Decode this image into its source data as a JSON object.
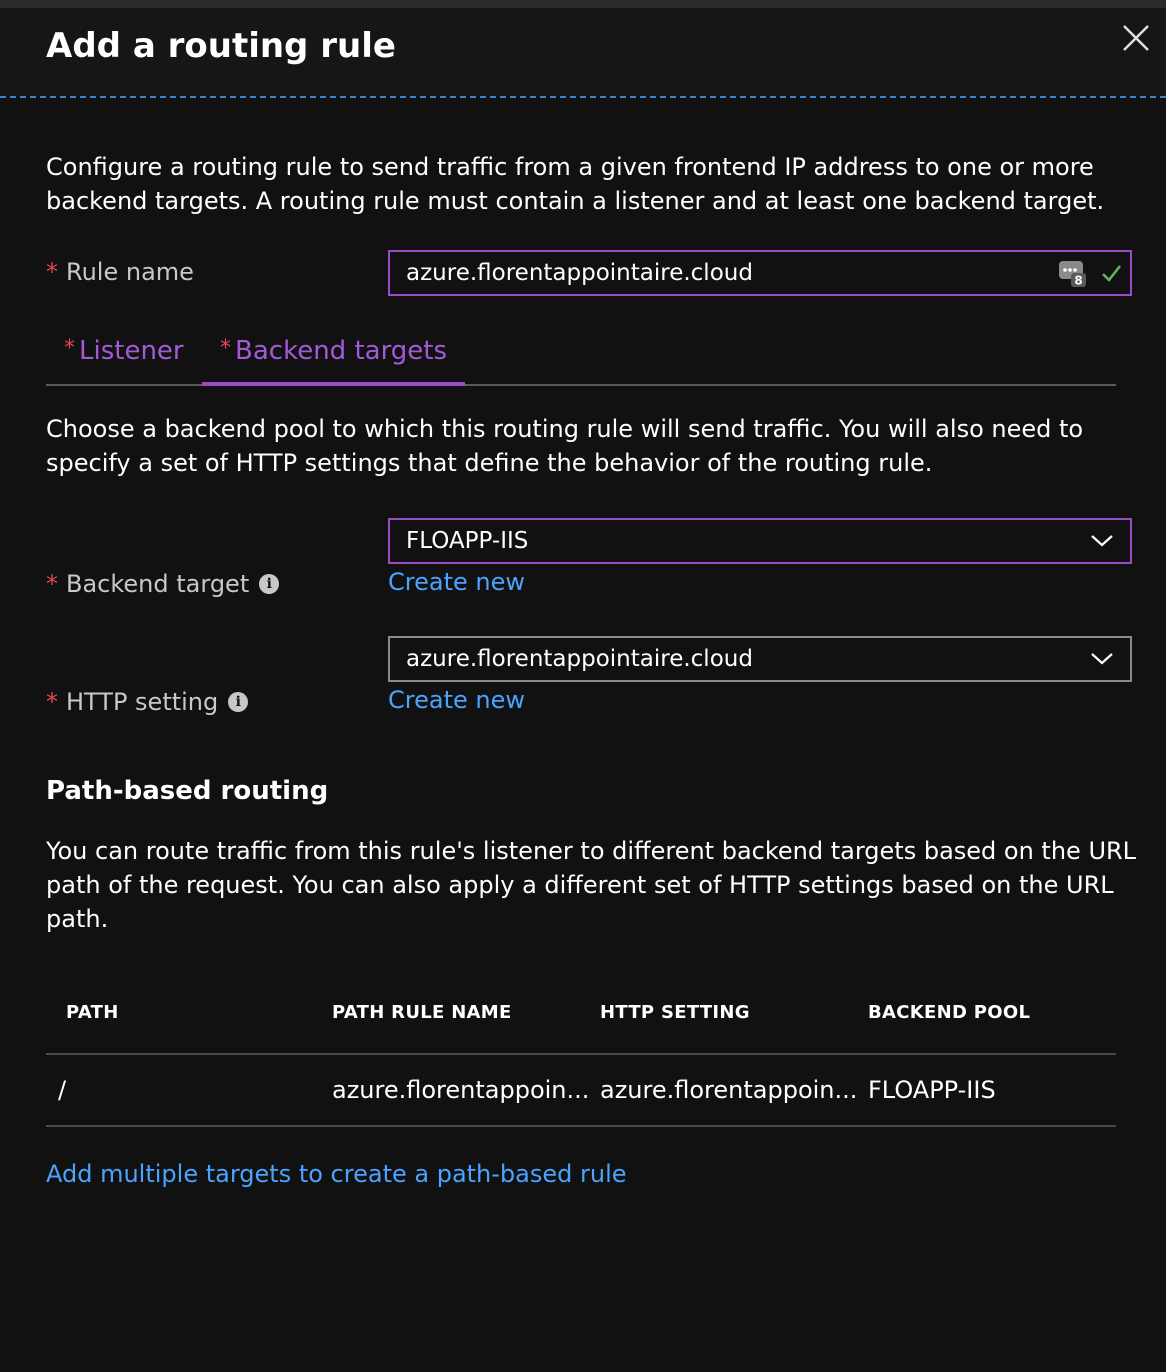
{
  "header": {
    "title": "Add a routing rule"
  },
  "intro": {
    "line1": "Configure a routing rule to send traffic from a given frontend IP address to one or more",
    "line2": "backend targets. A routing rule must contain a listener and at least one backend target."
  },
  "rule_name": {
    "label": "Rule name",
    "required": "*",
    "value": "azure.florentappointaire.cloud",
    "badge_count": "8"
  },
  "tabs": [
    {
      "label": "Listener",
      "required": "*",
      "active": false
    },
    {
      "label": "Backend targets",
      "required": "*",
      "active": true
    }
  ],
  "backend_description": {
    "line1": "Choose a backend pool to which this routing rule will send traffic. You will also need to",
    "line2": "specify a set of HTTP settings that define the behavior of the routing rule."
  },
  "backend_target": {
    "label": "Backend target",
    "required": "*",
    "selected": "FLOAPP-IIS",
    "create_new": "Create new"
  },
  "http_setting": {
    "label": "HTTP setting",
    "required": "*",
    "selected": "azure.florentappointaire.cloud",
    "create_new": "Create new"
  },
  "path_routing": {
    "heading": "Path-based routing",
    "line1": "You can route traffic from this rule's listener to different backend targets based on the URL",
    "line2": "path of the request. You can also apply a different set of HTTP settings based on the URL",
    "line3": "path.",
    "columns": [
      "PATH",
      "PATH RULE NAME",
      "HTTP SETTING",
      "BACKEND POOL"
    ],
    "rows": [
      [
        "/",
        "azure.florentappoin...",
        "azure.florentappoin...",
        "FLOAPP-IIS"
      ]
    ],
    "add_link": "Add multiple targets to create a path-based rule"
  },
  "colors": {
    "accent": "#9a4cc8",
    "link": "#4aa3ff",
    "required": "#e0484e",
    "valid": "#5cb85c"
  }
}
